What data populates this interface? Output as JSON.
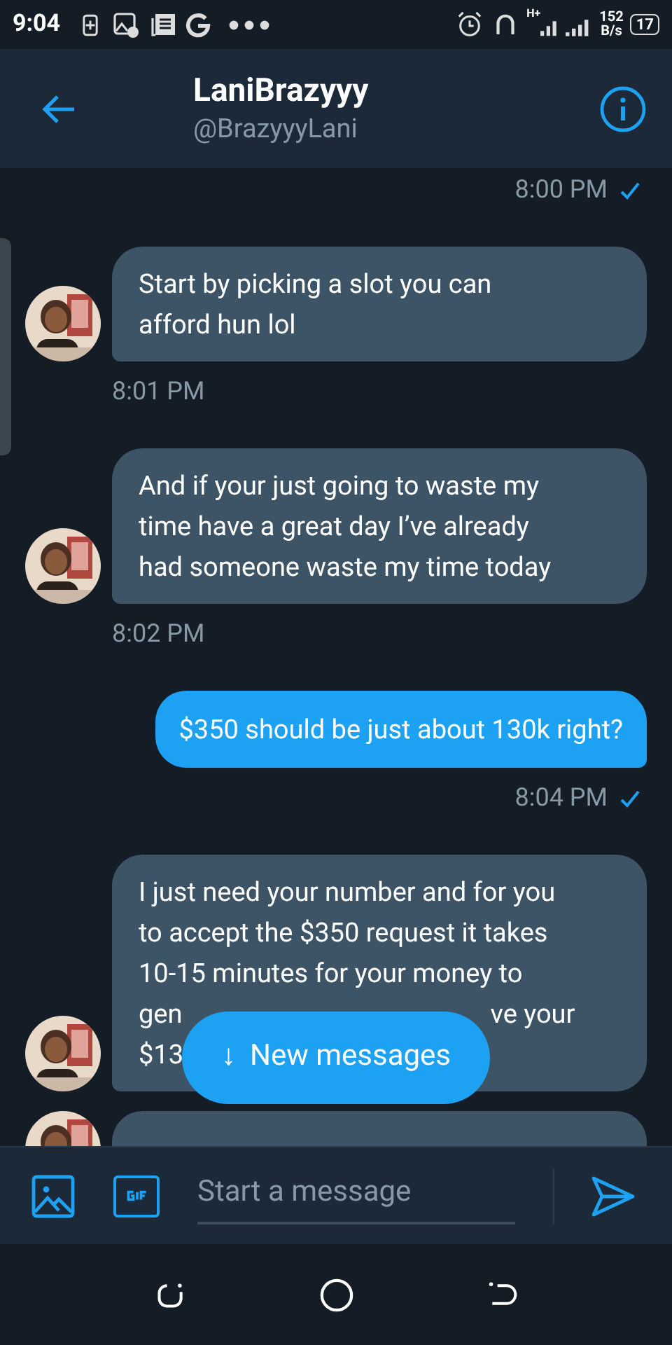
{
  "status_bar": {
    "time": "9:04",
    "network_label": "H+",
    "speed_value": "152",
    "speed_unit": "B/s",
    "battery": "17"
  },
  "header": {
    "title": "LaniBrazyyy",
    "handle": "@BrazyyyLani"
  },
  "messages": [
    {
      "kind": "stamp",
      "time": "8:00 PM",
      "read": true
    },
    {
      "kind": "received",
      "lines": [
        [
          "Start by picking a slot you can"
        ],
        [
          "afford hun lol"
        ]
      ],
      "time": "8:01 PM"
    },
    {
      "kind": "received",
      "lines": [
        [
          "And if your just going to waste my"
        ],
        [
          "time have a great day I’ve already"
        ],
        [
          "had someone waste my time today"
        ]
      ],
      "time": "8:02 PM"
    },
    {
      "kind": "sent",
      "lines": [
        [
          "$350 should be just about 130k right?"
        ]
      ],
      "time": "8:04 PM",
      "read": true
    },
    {
      "kind": "received",
      "lines": [
        [
          "I just need your number and for you"
        ],
        [
          "to accept the $350 request it takes"
        ],
        [
          "10-15 minutes for your money to"
        ],
        [
          "gen",
          "ve your"
        ],
        [
          "$13"
        ]
      ]
    },
    {
      "kind": "received_cut"
    }
  ],
  "new_messages_button": {
    "arrow": "↓",
    "label": "New messages"
  },
  "composer": {
    "placeholder": "Start a message"
  }
}
